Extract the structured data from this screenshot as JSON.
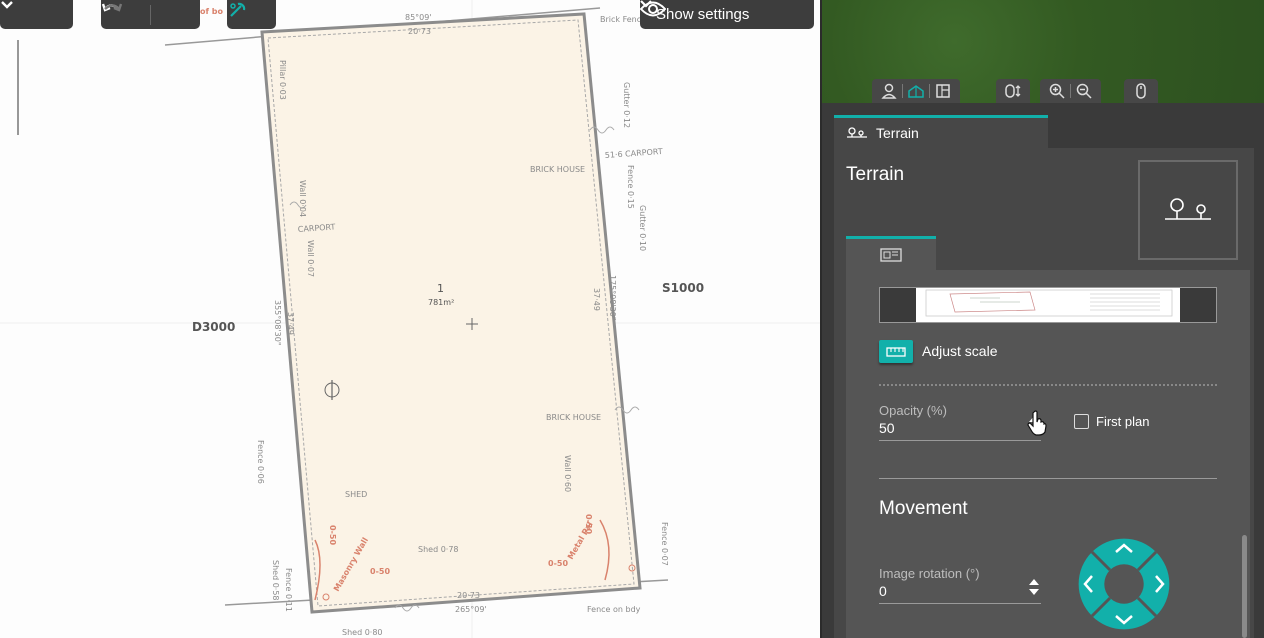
{
  "toolbar": {
    "show_settings_label": "Show settings"
  },
  "plan": {
    "bearing_top": "85°09'",
    "dist_top": "20·73",
    "bearing_bottom": "265°09'",
    "dist_bottom": "20·73",
    "bearing_left": "355°08'30\"",
    "dist_left": "37·49",
    "bearing_right": "175°08'30\"",
    "dist_right": "37·49",
    "lot_number": "1",
    "lot_area": "781m²",
    "label_d3000": "D3000",
    "label_s1000": "S1000",
    "carport_left": "CARPORT",
    "carport_right": "51·6 CARPORT",
    "brick_house_top": "BRICK HOUSE",
    "brick_house_right": "BRICK HOUSE",
    "shed_center": "SHED",
    "masonry_wall": "Masonry Wall",
    "retaining": "Metal Pal",
    "fence_on_bdy": "Fence on bdy",
    "shed_078": "Shed 0·78",
    "shed_080": "Shed 0·80",
    "val_050a": "0-50",
    "val_050b": "0-50",
    "val_050c": "0-50",
    "val_050d": "0-50",
    "pillar": "Pillar 0·03",
    "fence_006": "Fence 0·06",
    "wall_004": "Wall 0·04",
    "wall_007": "Wall 0·07",
    "gutter_012": "Gutter 0·12",
    "gutter_010": "Gutter 0·10",
    "fence_015": "Fence 0·15",
    "wall_060": "Wall 0·60",
    "fence_007": "Fence 0·07",
    "shed_058": "Shed 0·58",
    "fence_011": "Fence 0·11",
    "brick_fence": "Brick Fence on bdy",
    "top_red": "of bo"
  },
  "panel": {
    "tab_label": "Terrain",
    "title": "Terrain",
    "adjust_scale": "Adjust scale",
    "opacity_label": "Opacity (%)",
    "opacity_value": "50",
    "first_plan_label": "First plan",
    "first_plan_checked": false,
    "movement_title": "Movement",
    "rotation_label": "Image rotation (°)",
    "rotation_value": "0"
  },
  "colors": {
    "accent": "#12b0aa",
    "panel_bg": "#3a3a3a",
    "parcel_fill": "#fbf3e6"
  }
}
